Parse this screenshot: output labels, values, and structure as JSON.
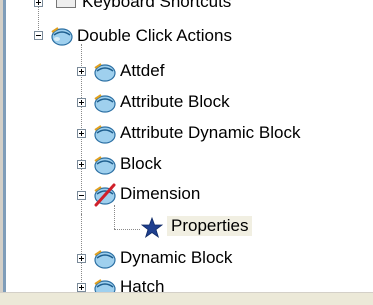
{
  "tree": {
    "partial_top_item": "Keyboard Shortcuts",
    "root": {
      "label": "Double Click Actions",
      "expanded": true,
      "icon": "mouse-icon"
    },
    "children": [
      {
        "label": "Attdef",
        "expanded": false,
        "icon": "mouse-icon"
      },
      {
        "label": "Attribute Block",
        "expanded": false,
        "icon": "mouse-icon"
      },
      {
        "label": "Attribute Dynamic Block",
        "expanded": false,
        "icon": "mouse-icon"
      },
      {
        "label": "Block",
        "expanded": false,
        "icon": "mouse-icon"
      },
      {
        "label": "Dimension",
        "expanded": true,
        "icon": "mouse-crossed-icon",
        "children": [
          {
            "label": "Properties",
            "icon": "star-icon",
            "selected": true
          }
        ]
      },
      {
        "label": "Dynamic Block",
        "expanded": false,
        "icon": "mouse-icon"
      },
      {
        "label": "Hatch",
        "expanded": false,
        "icon": "mouse-icon"
      }
    ]
  },
  "colors": {
    "selection_bg": "#f1efe2",
    "star": "#1f3f8f",
    "cross": "#d0202a"
  }
}
